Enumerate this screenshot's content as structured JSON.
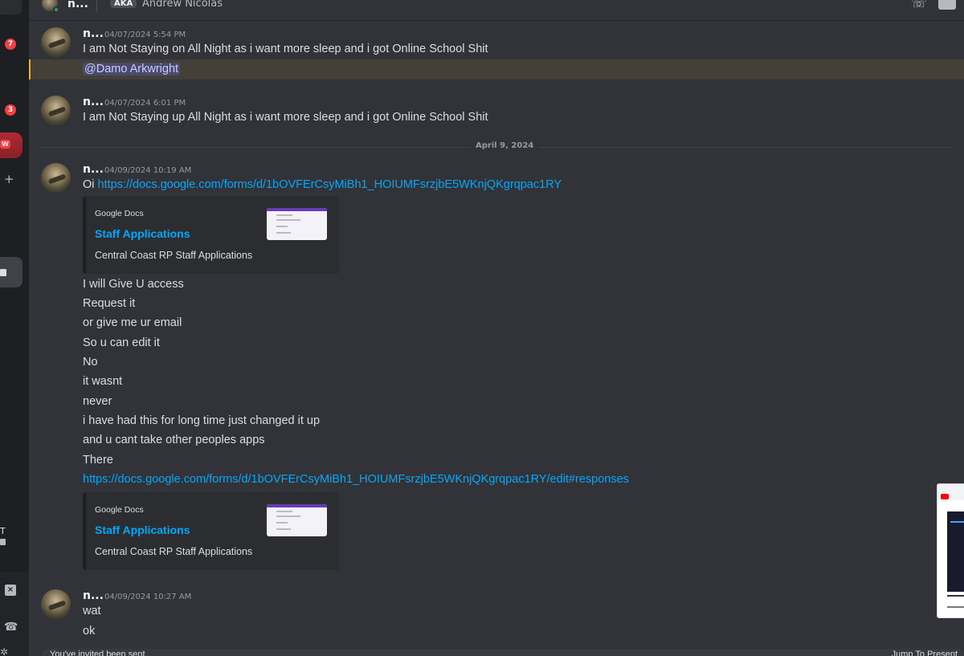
{
  "rail": {
    "badges": [
      "7",
      "3"
    ],
    "new_label": "W",
    "plus": "+",
    "t_label": "T"
  },
  "header": {
    "name": "n...",
    "aka_tag": "AKA",
    "aka_name": "Andrew Nicolas"
  },
  "messages": [
    {
      "author": "n...",
      "timestamp": "04/07/2024 5:54 PM",
      "lines": [
        "I am Not Staying on All Night as i want more sleep and i got Online School Shit"
      ],
      "mention": "@Damo Arkwright"
    },
    {
      "author": "n...",
      "timestamp": "04/07/2024 6:01 PM",
      "lines": [
        "I am Not Staying up All Night as i want more sleep and i got Online School Shit"
      ]
    }
  ],
  "divider": {
    "label": "April 9, 2024"
  },
  "message3": {
    "author": "n...",
    "timestamp": "04/09/2024 10:19 AM",
    "prefix": "Oi ",
    "link1": "https://docs.google.com/forms/d/1bOVFErCsyMiBh1_HOIUMFsrzjbE5WKnjQKgrqpac1RY",
    "embed": {
      "provider": "Google Docs",
      "title": "Staff Applications",
      "description": "Central Coast RP Staff Applications"
    },
    "lines": [
      "I will Give U access",
      "Request it",
      "or give me ur email",
      "So u can edit it",
      "No",
      "it wasnt",
      "never",
      "i have had this for long time just changed it up",
      "and u cant take other peoples apps",
      "There"
    ],
    "link2": "https://docs.google.com/forms/d/1bOVFErCsyMiBh1_HOIUMFsrzjbE5WKnjQKgrqpac1RY/edit#responses",
    "embed2": {
      "provider": "Google Docs",
      "title": "Staff Applications",
      "description": "Central Coast RP Staff Applications"
    }
  },
  "message4": {
    "author": "n...",
    "timestamp": "04/09/2024 10:27 AM",
    "lines": [
      "wat",
      "ok"
    ]
  },
  "composer": {
    "left_text": "You've invited been sent",
    "right_text": "Jump To Present"
  },
  "colors": {
    "background": "#313338",
    "link": "#00a8fc",
    "mention_highlight": "#f0b132",
    "badge": "#f23f43"
  }
}
